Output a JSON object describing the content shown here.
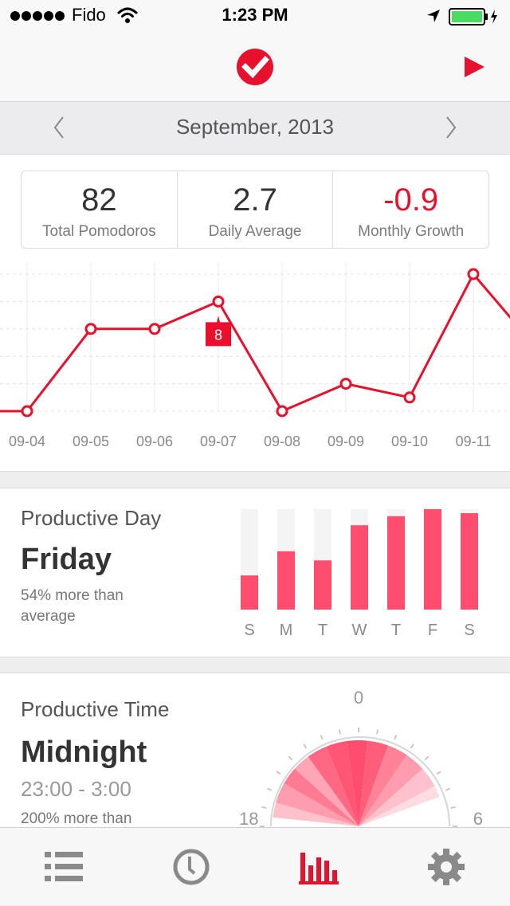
{
  "status_bar": {
    "carrier": "Fido",
    "time": "1:23 PM"
  },
  "nav": {
    "logo": "checkmark-logo",
    "play_icon": "play-icon"
  },
  "month_bar": {
    "label": "September, 2013"
  },
  "stats": [
    {
      "value": "82",
      "label": "Total Pomodoros"
    },
    {
      "value": "2.7",
      "label": "Daily Average"
    },
    {
      "value": "-0.9",
      "label": "Monthly Growth"
    }
  ],
  "line_chart": {
    "dates": [
      "09-04",
      "09-05",
      "09-06",
      "09-07",
      "09-08",
      "09-09",
      "09-10",
      "09-11"
    ],
    "tooltip": "8"
  },
  "chart_data": [
    {
      "type": "line",
      "x": [
        "09-04",
        "09-05",
        "09-06",
        "09-07",
        "09-08",
        "09-09",
        "09-10",
        "09-11"
      ],
      "series": [
        {
          "values": [
            0,
            6,
            6,
            8,
            0,
            2,
            1,
            10
          ]
        }
      ],
      "highlight": {
        "x": "09-07",
        "label": "8"
      },
      "ylim": [
        0,
        10
      ],
      "grid": true,
      "color": "#e8112d"
    },
    {
      "type": "bar",
      "categories": [
        "S",
        "M",
        "T",
        "W",
        "T",
        "F",
        "S"
      ],
      "values": [
        0.34,
        0.58,
        0.49,
        0.84,
        0.93,
        1.0,
        0.96
      ],
      "ylim": [
        0,
        1
      ],
      "color": "#ff4d6d",
      "track_color": "#f4f4f4"
    }
  ],
  "productive_day": {
    "title": "Productive Day",
    "value": "Friday",
    "sub_line1": "54% more than",
    "sub_line2": "average"
  },
  "productive_time": {
    "title": "Productive Time",
    "value": "Midnight",
    "range": "23:00 - 3:00",
    "sub": "200% more than",
    "dial_labels": {
      "top": "0",
      "left": "18",
      "right": "6"
    }
  },
  "tabs": [
    {
      "icon": "list-icon",
      "active": false
    },
    {
      "icon": "clock-icon",
      "active": false
    },
    {
      "icon": "bar-chart-icon",
      "active": true
    },
    {
      "icon": "gear-icon",
      "active": false
    }
  ],
  "colors": {
    "accent": "#e8112d",
    "bar": "#ff4d6d",
    "muted": "#8a8a8a"
  }
}
